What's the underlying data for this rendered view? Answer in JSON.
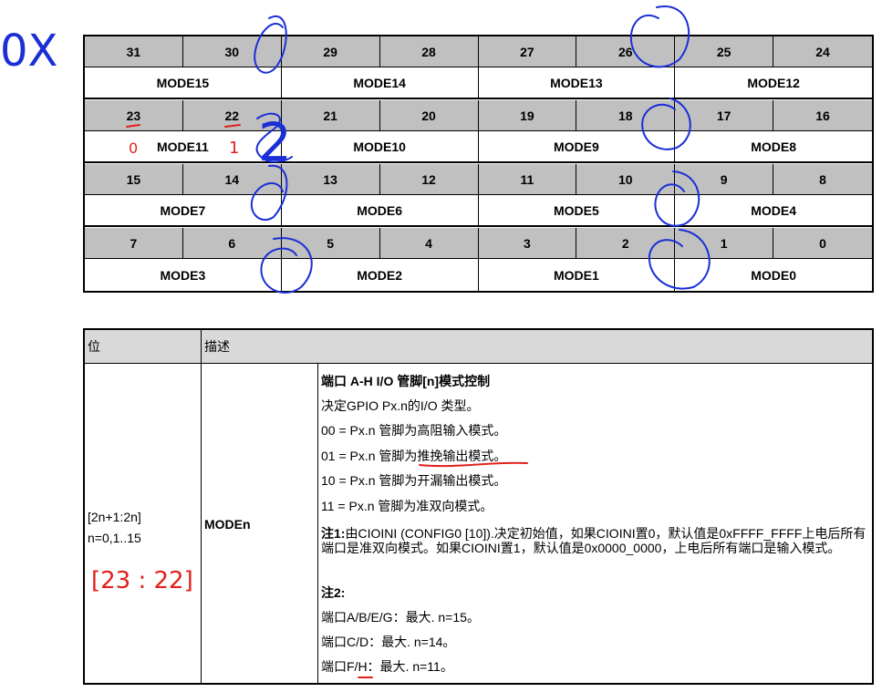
{
  "register": {
    "rows": [
      {
        "bits": [
          "31",
          "30",
          "29",
          "28",
          "27",
          "26",
          "25",
          "24"
        ],
        "modes": [
          "MODE15",
          "MODE14",
          "MODE13",
          "MODE12"
        ]
      },
      {
        "bits": [
          "23",
          "22",
          "21",
          "20",
          "19",
          "18",
          "17",
          "16"
        ],
        "modes": [
          "MODE11",
          "MODE10",
          "MODE9",
          "MODE8"
        ]
      },
      {
        "bits": [
          "15",
          "14",
          "13",
          "12",
          "11",
          "10",
          "9",
          "8"
        ],
        "modes": [
          "MODE7",
          "MODE6",
          "MODE5",
          "MODE4"
        ]
      },
      {
        "bits": [
          "7",
          "6",
          "5",
          "4",
          "3",
          "2",
          "1",
          "0"
        ],
        "modes": [
          "MODE3",
          "MODE2",
          "MODE1",
          "MODE0"
        ]
      }
    ]
  },
  "description": {
    "header": {
      "bit": "位",
      "desc": "描述"
    },
    "bit_range": "[2n+1:2n]",
    "n_range": "n=0,1..15",
    "field_name": "MODEn",
    "lines": {
      "title": "端口 A-H I/O 管脚[n]模式控制",
      "intro": "决定GPIO Px.n的I/O 类型。",
      "opt00": "00 = Px.n 管脚为高阻输入模式。",
      "opt01": "01 = Px.n 管脚为推挽输出模式。",
      "opt10": "10 = Px.n 管脚为开漏输出模式。",
      "opt11": "11 = Px.n 管脚为准双向模式。",
      "note1_label": "注1:",
      "note1_text": "由CIOINI (CONFIG0 [10]).决定初始值，如果CIOINI置0，默认值是0xFFFF_FFFF上电后所有端口是准双向模式。如果CIOINI置1，默认值是0x0000_0000，上电后所有端口是输入模式。",
      "note2_label": "注2:",
      "port_abeg": "端口A/B/E/G：最大. n=15。",
      "port_cd": "端口C/D：最大. n=14。",
      "port_fh": "端口F/H：最大. n=11。"
    }
  },
  "handwriting": {
    "corner": "0X",
    "bit23_mark": "0",
    "bit22_mark": "1",
    "big_digit": "2",
    "range_note": "[23 : 22]",
    "ink_blue": "#1a2fd6",
    "ink_red": "#e0201b"
  }
}
